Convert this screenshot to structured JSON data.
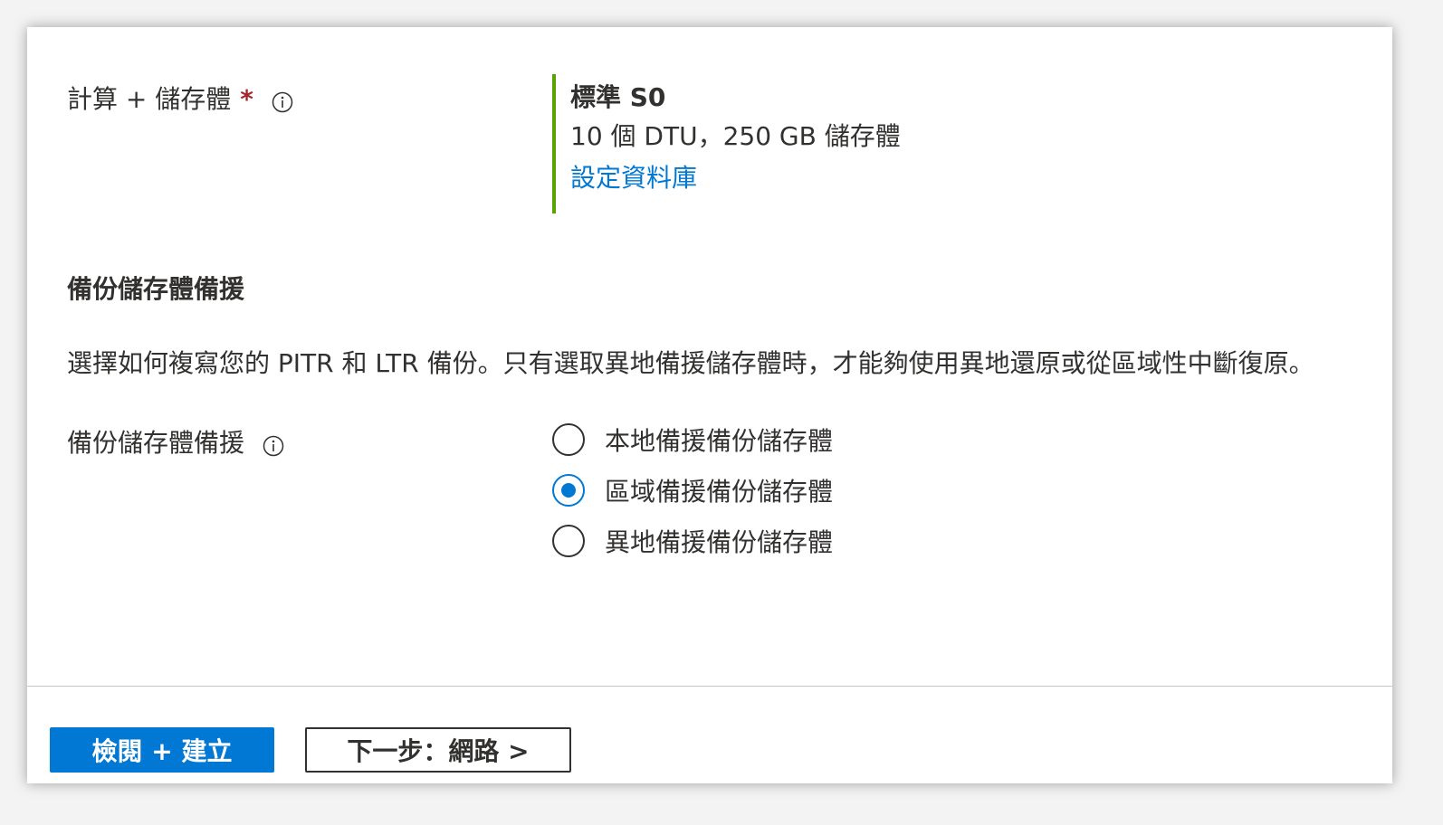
{
  "compute_storage": {
    "label": "計算 + 儲存體",
    "required_marker": "*",
    "tier": "標準 S0",
    "detail": "10 個 DTU，250 GB 儲存體",
    "configure_link": "設定資料庫"
  },
  "backup_section": {
    "heading": "備份儲存體備援",
    "description": "選擇如何複寫您的 PITR 和 LTR 備份。只有選取異地備援儲存體時，才能夠使用異地還原或從區域性中斷復原。",
    "field_label": "備份儲存體備援",
    "options": [
      {
        "label": "本地備援備份儲存體",
        "selected": false
      },
      {
        "label": "區域備援備份儲存體",
        "selected": true
      },
      {
        "label": "異地備援備份儲存體",
        "selected": false
      }
    ]
  },
  "footer": {
    "review_create_label": "檢閱 + 建立",
    "next_label": "下一步：網路 >"
  },
  "colors": {
    "accent": "#0078d4",
    "required": "#a4262c",
    "tier_bar": "#57a300"
  }
}
